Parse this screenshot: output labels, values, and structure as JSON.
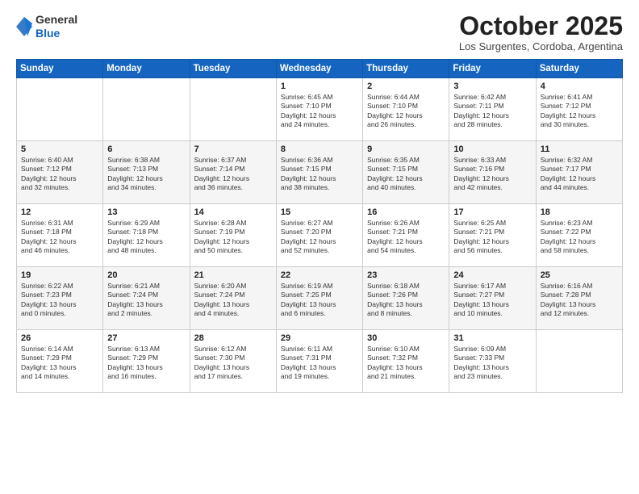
{
  "logo": {
    "general": "General",
    "blue": "Blue"
  },
  "header": {
    "month": "October 2025",
    "location": "Los Surgentes, Cordoba, Argentina"
  },
  "weekdays": [
    "Sunday",
    "Monday",
    "Tuesday",
    "Wednesday",
    "Thursday",
    "Friday",
    "Saturday"
  ],
  "weeks": [
    [
      {
        "day": "",
        "info": ""
      },
      {
        "day": "",
        "info": ""
      },
      {
        "day": "",
        "info": ""
      },
      {
        "day": "1",
        "info": "Sunrise: 6:45 AM\nSunset: 7:10 PM\nDaylight: 12 hours\nand 24 minutes."
      },
      {
        "day": "2",
        "info": "Sunrise: 6:44 AM\nSunset: 7:10 PM\nDaylight: 12 hours\nand 26 minutes."
      },
      {
        "day": "3",
        "info": "Sunrise: 6:42 AM\nSunset: 7:11 PM\nDaylight: 12 hours\nand 28 minutes."
      },
      {
        "day": "4",
        "info": "Sunrise: 6:41 AM\nSunset: 7:12 PM\nDaylight: 12 hours\nand 30 minutes."
      }
    ],
    [
      {
        "day": "5",
        "info": "Sunrise: 6:40 AM\nSunset: 7:12 PM\nDaylight: 12 hours\nand 32 minutes."
      },
      {
        "day": "6",
        "info": "Sunrise: 6:38 AM\nSunset: 7:13 PM\nDaylight: 12 hours\nand 34 minutes."
      },
      {
        "day": "7",
        "info": "Sunrise: 6:37 AM\nSunset: 7:14 PM\nDaylight: 12 hours\nand 36 minutes."
      },
      {
        "day": "8",
        "info": "Sunrise: 6:36 AM\nSunset: 7:15 PM\nDaylight: 12 hours\nand 38 minutes."
      },
      {
        "day": "9",
        "info": "Sunrise: 6:35 AM\nSunset: 7:15 PM\nDaylight: 12 hours\nand 40 minutes."
      },
      {
        "day": "10",
        "info": "Sunrise: 6:33 AM\nSunset: 7:16 PM\nDaylight: 12 hours\nand 42 minutes."
      },
      {
        "day": "11",
        "info": "Sunrise: 6:32 AM\nSunset: 7:17 PM\nDaylight: 12 hours\nand 44 minutes."
      }
    ],
    [
      {
        "day": "12",
        "info": "Sunrise: 6:31 AM\nSunset: 7:18 PM\nDaylight: 12 hours\nand 46 minutes."
      },
      {
        "day": "13",
        "info": "Sunrise: 6:29 AM\nSunset: 7:18 PM\nDaylight: 12 hours\nand 48 minutes."
      },
      {
        "day": "14",
        "info": "Sunrise: 6:28 AM\nSunset: 7:19 PM\nDaylight: 12 hours\nand 50 minutes."
      },
      {
        "day": "15",
        "info": "Sunrise: 6:27 AM\nSunset: 7:20 PM\nDaylight: 12 hours\nand 52 minutes."
      },
      {
        "day": "16",
        "info": "Sunrise: 6:26 AM\nSunset: 7:21 PM\nDaylight: 12 hours\nand 54 minutes."
      },
      {
        "day": "17",
        "info": "Sunrise: 6:25 AM\nSunset: 7:21 PM\nDaylight: 12 hours\nand 56 minutes."
      },
      {
        "day": "18",
        "info": "Sunrise: 6:23 AM\nSunset: 7:22 PM\nDaylight: 12 hours\nand 58 minutes."
      }
    ],
    [
      {
        "day": "19",
        "info": "Sunrise: 6:22 AM\nSunset: 7:23 PM\nDaylight: 13 hours\nand 0 minutes."
      },
      {
        "day": "20",
        "info": "Sunrise: 6:21 AM\nSunset: 7:24 PM\nDaylight: 13 hours\nand 2 minutes."
      },
      {
        "day": "21",
        "info": "Sunrise: 6:20 AM\nSunset: 7:24 PM\nDaylight: 13 hours\nand 4 minutes."
      },
      {
        "day": "22",
        "info": "Sunrise: 6:19 AM\nSunset: 7:25 PM\nDaylight: 13 hours\nand 6 minutes."
      },
      {
        "day": "23",
        "info": "Sunrise: 6:18 AM\nSunset: 7:26 PM\nDaylight: 13 hours\nand 8 minutes."
      },
      {
        "day": "24",
        "info": "Sunrise: 6:17 AM\nSunset: 7:27 PM\nDaylight: 13 hours\nand 10 minutes."
      },
      {
        "day": "25",
        "info": "Sunrise: 6:16 AM\nSunset: 7:28 PM\nDaylight: 13 hours\nand 12 minutes."
      }
    ],
    [
      {
        "day": "26",
        "info": "Sunrise: 6:14 AM\nSunset: 7:29 PM\nDaylight: 13 hours\nand 14 minutes."
      },
      {
        "day": "27",
        "info": "Sunrise: 6:13 AM\nSunset: 7:29 PM\nDaylight: 13 hours\nand 16 minutes."
      },
      {
        "day": "28",
        "info": "Sunrise: 6:12 AM\nSunset: 7:30 PM\nDaylight: 13 hours\nand 17 minutes."
      },
      {
        "day": "29",
        "info": "Sunrise: 6:11 AM\nSunset: 7:31 PM\nDaylight: 13 hours\nand 19 minutes."
      },
      {
        "day": "30",
        "info": "Sunrise: 6:10 AM\nSunset: 7:32 PM\nDaylight: 13 hours\nand 21 minutes."
      },
      {
        "day": "31",
        "info": "Sunrise: 6:09 AM\nSunset: 7:33 PM\nDaylight: 13 hours\nand 23 minutes."
      },
      {
        "day": "",
        "info": ""
      }
    ]
  ]
}
